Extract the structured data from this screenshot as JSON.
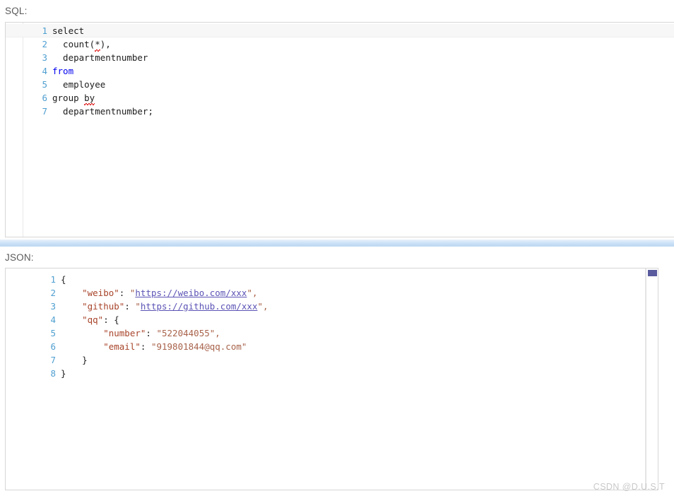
{
  "labels": {
    "sql": "SQL:",
    "json": "JSON:"
  },
  "colors": {
    "line_number": "#4f9fd0",
    "keyword": "#0000ee",
    "json_key": "#a8442a",
    "json_string": "#a8624a",
    "json_link": "#5b53b5",
    "scrollbar_thumb": "#5a5a9e",
    "watermark": "#c9c9c9",
    "panel_border": "#d6d6d6",
    "current_line": "#f7f7f7"
  },
  "sql_editor": {
    "language": "sql",
    "current_line": 1,
    "line_numbers": [
      1,
      2,
      3,
      4,
      5,
      6,
      7
    ],
    "lines": [
      {
        "n": 1,
        "tokens": [
          {
            "t": "select",
            "c": "plain"
          }
        ]
      },
      {
        "n": 2,
        "tokens": [
          {
            "t": "  count(",
            "c": "plain"
          },
          {
            "t": "*",
            "c": "plain",
            "spell": true
          },
          {
            "t": "),",
            "c": "plain"
          }
        ]
      },
      {
        "n": 3,
        "tokens": [
          {
            "t": "  departmentnumber",
            "c": "plain"
          }
        ]
      },
      {
        "n": 4,
        "tokens": [
          {
            "t": "from",
            "c": "kw"
          }
        ]
      },
      {
        "n": 5,
        "tokens": [
          {
            "t": "  employee",
            "c": "plain"
          }
        ]
      },
      {
        "n": 6,
        "tokens": [
          {
            "t": "group ",
            "c": "plain"
          },
          {
            "t": "by",
            "c": "plain",
            "spell": true
          }
        ]
      },
      {
        "n": 7,
        "tokens": [
          {
            "t": "  departmentnumber;",
            "c": "plain"
          }
        ]
      }
    ],
    "plain_text": "select\n  count(*),\n  departmentnumber\nfrom\n  employee\ngroup by\n  departmentnumber;"
  },
  "json_editor": {
    "language": "json",
    "line_numbers": [
      1,
      2,
      3,
      4,
      5,
      6,
      7,
      8
    ],
    "lines": [
      {
        "n": 1,
        "tokens": [
          {
            "t": "{",
            "c": "brace"
          }
        ]
      },
      {
        "n": 2,
        "tokens": [
          {
            "t": "    \"weibo\"",
            "c": "key"
          },
          {
            "t": ": ",
            "c": "punct"
          },
          {
            "t": "\"",
            "c": "str"
          },
          {
            "t": "https://weibo.com/xxx",
            "c": "link"
          },
          {
            "t": "\",",
            "c": "str"
          }
        ]
      },
      {
        "n": 3,
        "tokens": [
          {
            "t": "    \"github\"",
            "c": "key"
          },
          {
            "t": ": ",
            "c": "punct"
          },
          {
            "t": "\"",
            "c": "str"
          },
          {
            "t": "https://github.com/xxx",
            "c": "link"
          },
          {
            "t": "\",",
            "c": "str"
          }
        ]
      },
      {
        "n": 4,
        "tokens": [
          {
            "t": "    \"qq\"",
            "c": "key"
          },
          {
            "t": ": ",
            "c": "punct"
          },
          {
            "t": "{",
            "c": "brace"
          }
        ]
      },
      {
        "n": 5,
        "tokens": [
          {
            "t": "        \"number\"",
            "c": "key"
          },
          {
            "t": ": ",
            "c": "punct"
          },
          {
            "t": "\"522044055\",",
            "c": "str"
          }
        ]
      },
      {
        "n": 6,
        "tokens": [
          {
            "t": "        \"email\"",
            "c": "key"
          },
          {
            "t": ": ",
            "c": "punct"
          },
          {
            "t": "\"919801844@qq.com\"",
            "c": "str"
          }
        ]
      },
      {
        "n": 7,
        "tokens": [
          {
            "t": "    }",
            "c": "brace"
          }
        ]
      },
      {
        "n": 8,
        "tokens": [
          {
            "t": "}",
            "c": "brace"
          }
        ]
      }
    ],
    "values": {
      "weibo": "https://weibo.com/xxx",
      "github": "https://github.com/xxx",
      "qq": {
        "number": "522044055",
        "email": "919801844@qq.com"
      }
    },
    "plain_text": "{\n    \"weibo\": \"https://weibo.com/xxx\",\n    \"github\": \"https://github.com/xxx\",\n    \"qq\": {\n        \"number\": \"522044055\",\n        \"email\": \"919801844@qq.com\"\n    }\n}"
  },
  "watermark": {
    "text": "CSDN @D.U.S.T"
  }
}
